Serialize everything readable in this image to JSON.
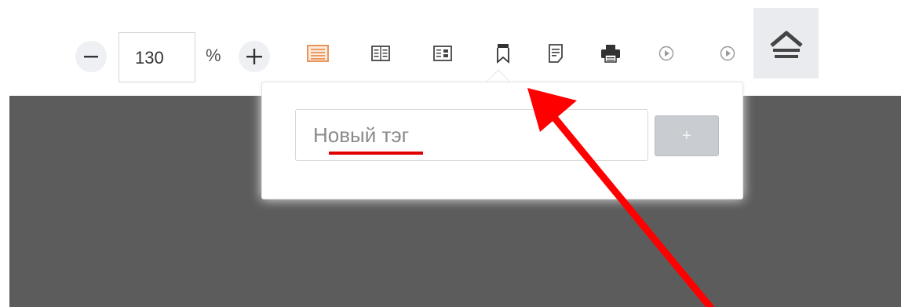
{
  "zoom": {
    "value": "130",
    "unit": "%"
  },
  "tag_popover": {
    "placeholder": "Новый тэг",
    "add_label": "+"
  },
  "icons": {
    "zoom_out": "minus-icon",
    "zoom_in": "plus-icon",
    "single_page": "single-page-view-icon",
    "two_page": "two-page-view-icon",
    "thumbnails": "thumbnail-view-icon",
    "bookmark": "bookmark-icon",
    "notes": "notes-icon",
    "print": "print-icon",
    "play_1": "play-icon",
    "play_2": "play-icon",
    "collapse": "collapse-toolbar-icon"
  },
  "colors": {
    "active_view": "#e8955c",
    "annotation_red": "#ff0000",
    "dark_area": "#5c5c5c"
  }
}
